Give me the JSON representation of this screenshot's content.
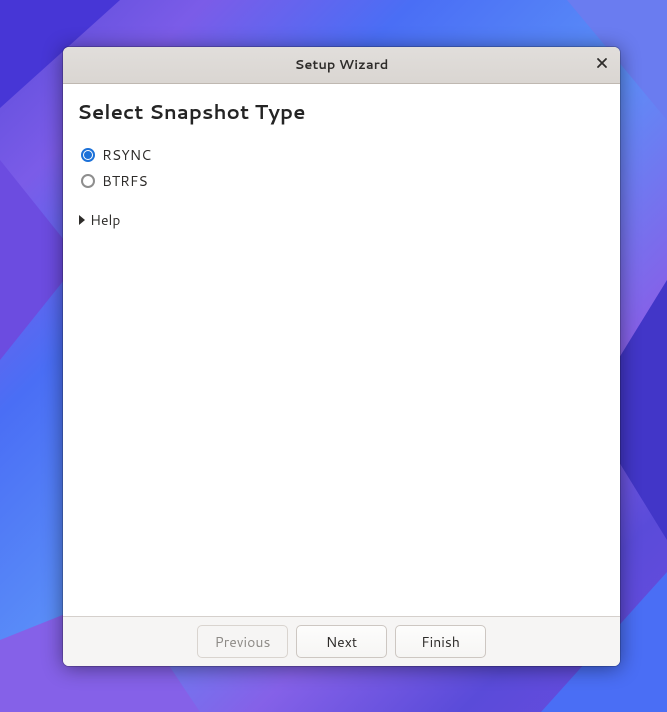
{
  "window": {
    "title": "Setup Wizard"
  },
  "page": {
    "heading": "Select Snapshot Type",
    "options": {
      "rsync": {
        "label": "RSYNC",
        "selected": true
      },
      "btrfs": {
        "label": "BTRFS",
        "selected": false
      }
    },
    "help": {
      "label": "Help",
      "expanded": false
    }
  },
  "buttons": {
    "previous": {
      "label": "Previous",
      "enabled": false
    },
    "next": {
      "label": "Next",
      "enabled": true
    },
    "finish": {
      "label": "Finish",
      "enabled": true
    }
  }
}
